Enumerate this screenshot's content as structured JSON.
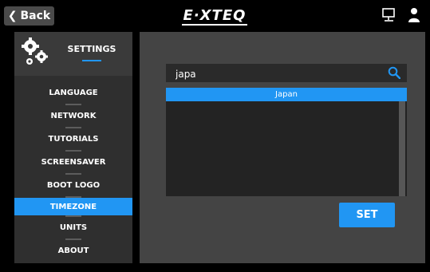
{
  "topbar": {
    "back_label": "Back",
    "logo_text": "E·XTEQ"
  },
  "sidebar": {
    "title": "SETTINGS",
    "items": [
      {
        "label": "LANGUAGE"
      },
      {
        "label": "NETWORK"
      },
      {
        "label": "TUTORIALS"
      },
      {
        "label": "SCREENSAVER"
      },
      {
        "label": "BOOT LOGO"
      },
      {
        "label": "TIMEZONE",
        "active": true
      },
      {
        "label": "UNITS"
      },
      {
        "label": "ABOUT"
      }
    ]
  },
  "timezone": {
    "search_value": "japa",
    "results": [
      "Japan"
    ],
    "set_label": "SET"
  },
  "colors": {
    "accent": "#2196f3",
    "panel": "#444444",
    "sidebar": "#2f2f2f"
  },
  "icons": [
    "back-chevron-icon",
    "network-icon",
    "user-icon",
    "gears-icon",
    "search-icon"
  ]
}
